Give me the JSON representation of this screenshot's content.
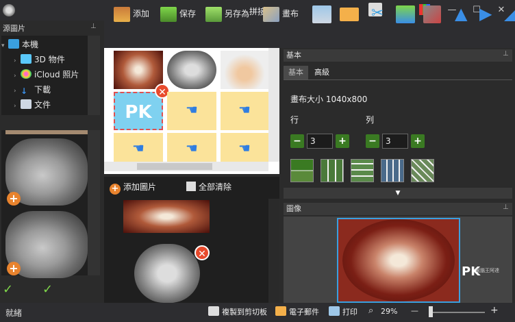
{
  "window": {
    "title": "拼接",
    "controls": [
      "—",
      "☐",
      "✕"
    ]
  },
  "left_panel": {
    "title": "源圖片",
    "pin": "📌",
    "tree": [
      {
        "label": "本機",
        "expanded": true,
        "icon": "computer-icon"
      },
      {
        "label": "3D 物件",
        "icon": "cube-icon"
      },
      {
        "label": "iCloud 照片",
        "icon": "icloud-photos-icon"
      },
      {
        "label": "下載",
        "icon": "download-arrow-icon"
      },
      {
        "label": "文件",
        "icon": "document-icon"
      }
    ],
    "confirm_icon": "✓",
    "confirm_all_icon": "✓"
  },
  "toolbar": {
    "add": "添加",
    "save": "保存",
    "save_as": "另存為",
    "canvas": "畫布"
  },
  "image_list": {
    "add_image": "添加圖片",
    "clear_all": "全部清除"
  },
  "basic_panel": {
    "title": "基本",
    "tabs": [
      "基本",
      "高級"
    ],
    "canvas_size_label": "畫布大小 1040x800",
    "rows_label": "行",
    "rows_value": "3",
    "cols_label": "列",
    "cols_value": "3",
    "expander": "▼"
  },
  "image_panel": {
    "title": "圖像",
    "watermark": "PK",
    "watermark_sub": "電腦王阿達"
  },
  "status_bar": {
    "status": "就緒",
    "copy_clipboard": "複製到剪切板",
    "email": "電子郵件",
    "print": "打印",
    "zoom": "29%",
    "zoom_minus": "—",
    "zoom_plus": "+"
  },
  "canvas_preview": {
    "pk_text": "PK",
    "remove": "✕"
  },
  "colors": {
    "accent": "#3aa0e0",
    "grid_cell": "#fbe39a",
    "add_orange": "#e8832e",
    "remove_red": "#e84a2c",
    "step_green": "#3a7a22"
  }
}
